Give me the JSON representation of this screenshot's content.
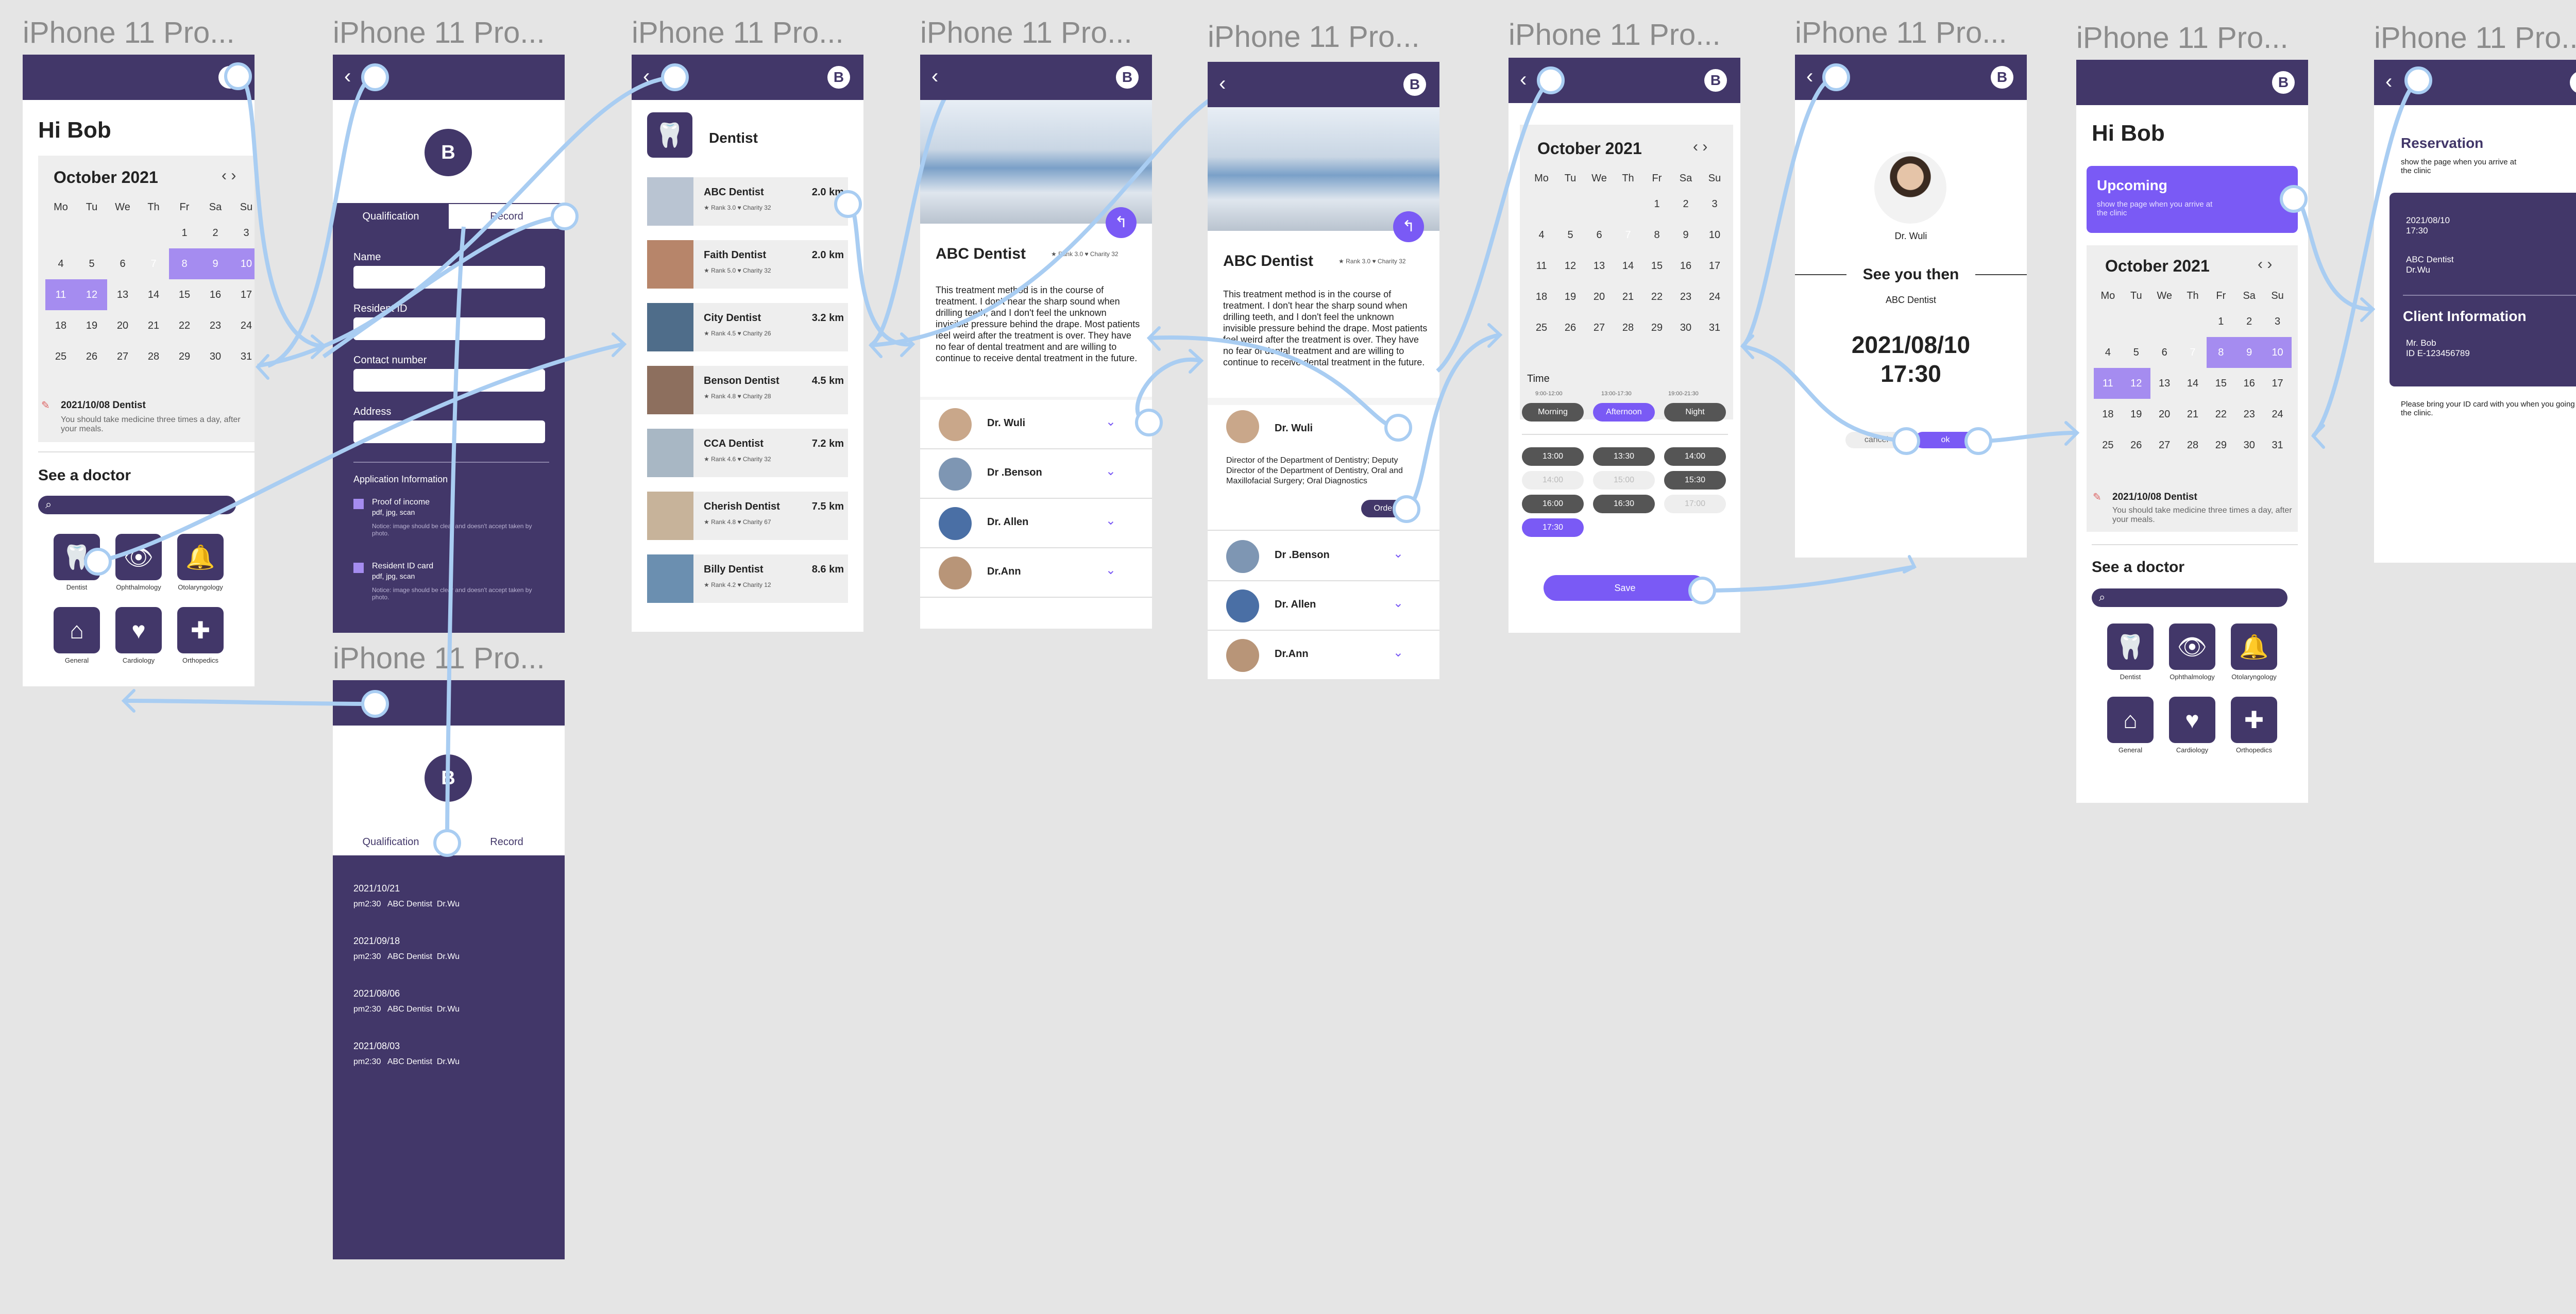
{
  "frame_label": "iPhone 11 Pro...",
  "greeting": "Hi Bob",
  "avatar_letter": "B",
  "calendar": {
    "month": "October 2021",
    "weekdays": [
      "Mo",
      "Tu",
      "We",
      "Th",
      "Fr",
      "Sa",
      "Su"
    ],
    "days": [
      "1",
      "2",
      "3",
      "4",
      "5",
      "6",
      "7",
      "8",
      "9",
      "10",
      "11",
      "12",
      "13",
      "14",
      "15",
      "16",
      "17",
      "18",
      "19",
      "20",
      "21",
      "22",
      "23",
      "24",
      "25",
      "26",
      "27",
      "28",
      "29",
      "30",
      "31"
    ]
  },
  "reminder": {
    "date": "2021/10/08 Dentist",
    "note": "You should take medicine three times a day, after your meals."
  },
  "see_doctor": "See a doctor",
  "categories": [
    "Dentist",
    "Ophthalmology",
    "Otolaryngology",
    "General",
    "Cardiology",
    "Orthopedics"
  ],
  "tabs": {
    "qualification": "Qualification",
    "record": "Record"
  },
  "form": {
    "name": "Name",
    "resident": "Resident ID",
    "contact": "Contact number",
    "address": "Address",
    "app_info": "Application Information",
    "proof_income": "Proof of income",
    "proof_income_fmt": "pdf, jpg, scan",
    "resident_card": "Resident ID card",
    "resident_card_fmt": "pdf, jpg, scan",
    "notice": "Notice: image should be clear and doesn't accept taken by photo."
  },
  "records": [
    {
      "date": "2021/10/21",
      "detail": "pm2:30   ABC Dentist  Dr.Wu"
    },
    {
      "date": "2021/09/18",
      "detail": "pm2:30   ABC Dentist  Dr.Wu"
    },
    {
      "date": "2021/08/06",
      "detail": "pm2:30   ABC Dentist  Dr.Wu"
    },
    {
      "date": "2021/08/03",
      "detail": "pm2:30   ABC Dentist  Dr.Wu"
    }
  ],
  "clinic_list": {
    "title": "Dentist",
    "items": [
      {
        "name": "ABC Dentist",
        "dist": "2.0 km",
        "meta": "★ Rank 3.0   ♥ Charity 32"
      },
      {
        "name": "Faith Dentist",
        "dist": "2.0 km",
        "meta": "★ Rank 5.0   ♥ Charity 32"
      },
      {
        "name": "City Dentist",
        "dist": "3.2 km",
        "meta": "★ Rank 4.5   ♥ Charity 26"
      },
      {
        "name": "Benson Dentist",
        "dist": "4.5 km",
        "meta": "★ Rank 4.8   ♥ Charity 28"
      },
      {
        "name": "CCA Dentist",
        "dist": "7.2 km",
        "meta": "★ Rank 4.6   ♥ Charity 32"
      },
      {
        "name": "Cherish Dentist",
        "dist": "7.5 km",
        "meta": "★ Rank 4.8   ♥ Charity 67"
      },
      {
        "name": "Billy Dentist",
        "dist": "8.6 km",
        "meta": "★ Rank 4.2   ♥ Charity 12"
      }
    ]
  },
  "clinic": {
    "name": "ABC Dentist",
    "meta": "★ Rank 3.0   ♥ Charity 32",
    "desc": "This treatment method is in the course of treatment. I don't hear the sharp sound when drilling teeth, and I don't feel the unknown invisible pressure behind the drape. Most patients feel weird after the treatment is over. They have no fear of dental treatment and are willing to continue to receive dental treatment in the future.",
    "doctors": [
      "Dr. Wuli",
      "Dr .Benson",
      "Dr. Allen",
      "Dr.Ann"
    ],
    "doctor_bio": "Director of the Department of Dentistry; Deputy Director of the Department of Dentistry, Oral and Maxillofacial Surgery; Oral Diagnostics",
    "order": "Order"
  },
  "time": {
    "label": "Time",
    "periods": [
      "Morning",
      "Afternoon",
      "Night"
    ],
    "ranges": [
      "9:00-12:00",
      "13:00-17:30",
      "19:00-21:30"
    ],
    "slots": [
      "13:00",
      "13:30",
      "14:00",
      "14:00",
      "15:00",
      "15:30",
      "16:00",
      "16:30",
      "17:00",
      "17:30"
    ],
    "save": "Save"
  },
  "confirm": {
    "doctor": "Dr. Wuli",
    "heading": "See you then",
    "clinic": "ABC Dentist",
    "date": "2021/08/10",
    "time": "17:30",
    "cancel": "cancel",
    "ok": "ok"
  },
  "upcoming": {
    "title": "Upcoming",
    "sub": "show the page when you arrive at the clinic"
  },
  "reservation": {
    "title": "Reservation",
    "sub": "show the page when you arrive at the clinic",
    "datetime": "2021/08/10\n17:30",
    "place": "ABC Dentist\nDr.Wu",
    "client_title": "Client Information",
    "client": "Mr. Bob\nID  E-123456789",
    "note": "Please bring your ID card with you when you going to the clinic."
  },
  "colors": {
    "brand": "#423769",
    "accent": "#7a5af5",
    "light_accent": "#a58cf0",
    "connector": "#a9cdf2",
    "canvas": "#e5e5e5"
  }
}
